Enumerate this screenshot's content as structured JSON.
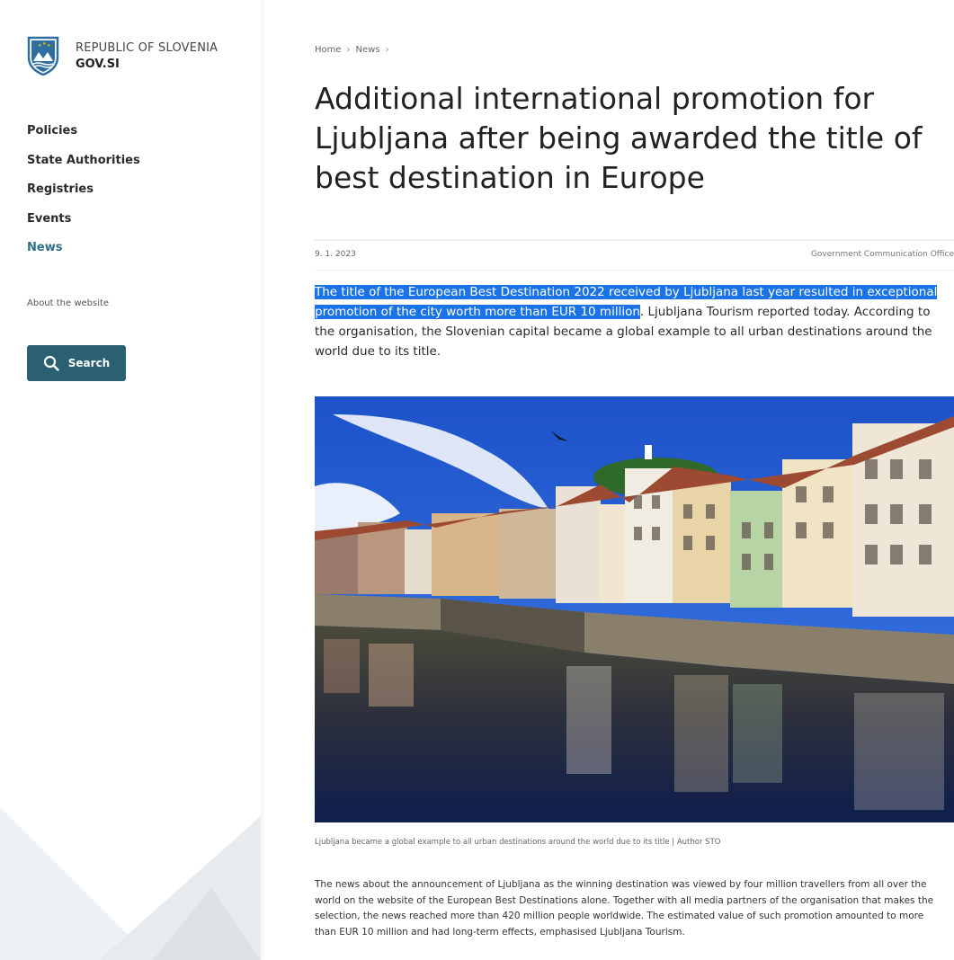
{
  "site": {
    "name_line1": "REPUBLIC OF SLOVENIA",
    "name_line2": "GOV.SI",
    "logo_icon": "slovenia-coat-of-arms"
  },
  "sidebar": {
    "nav": [
      {
        "label": "Policies",
        "active": false
      },
      {
        "label": "State Authorities",
        "active": false
      },
      {
        "label": "Registries",
        "active": false
      },
      {
        "label": "Events",
        "active": false
      },
      {
        "label": "News",
        "active": true
      }
    ],
    "about_label": "About the website",
    "search_label": "Search",
    "search_icon": "search-icon"
  },
  "breadcrumb": [
    "Home",
    "News"
  ],
  "article": {
    "title": "Additional international promotion for Ljubljana after being awarded the title of best destination in Europe",
    "date": "9. 1. 2023",
    "organisation": "Government Communication Office",
    "lead_highlighted": "The title of the European Best Destination 2022 received by Ljubljana last year resulted in exceptional promotion of the city worth more than EUR 10 million",
    "lead_rest": ". Ljubljana Tourism reported today. According to the organisation, the Slovenian capital became a global example to all urban destinations around the world due to its title.",
    "image_caption": "Ljubljana became a global example to all urban destinations around the world due to its title | Author STO",
    "body": "The news about the announcement of Ljubljana as the winning destination was viewed by four million travellers from all over the world on the website of the European Best Destinations alone. Together with all media partners of the organisation that makes the selection, the news reached more than 420 million people worldwide. The estimated value of such promotion amounted to more than EUR 10 million and had long-term effects, emphasised Ljubljana Tourism."
  },
  "colors": {
    "accent": "#2e6f86",
    "search_button": "#2b5f72",
    "highlight": "#1a73e8"
  }
}
